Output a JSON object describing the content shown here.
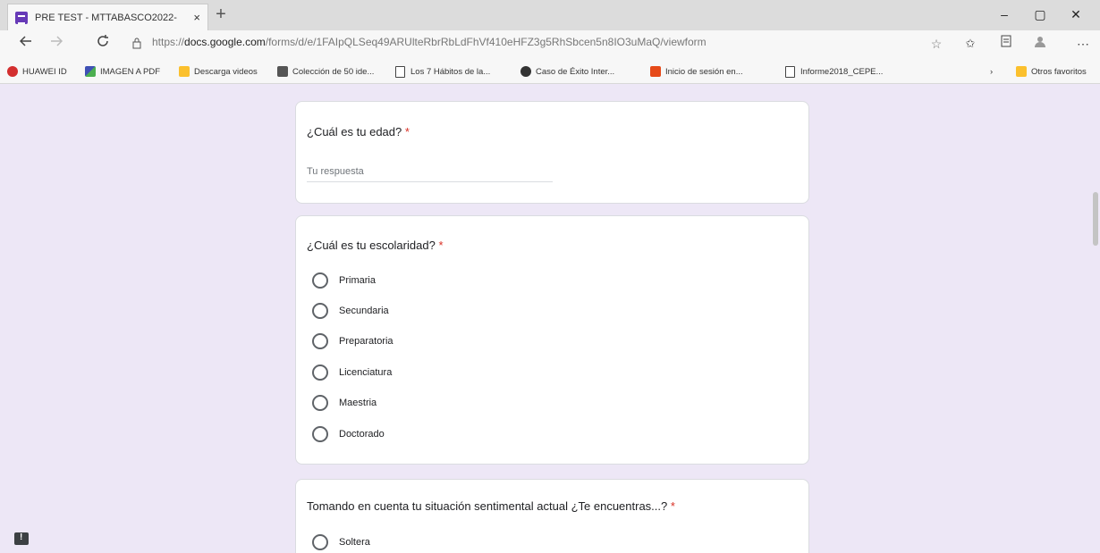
{
  "browser": {
    "tab_title": "PRE TEST - MTTABASCO2022-",
    "tab_close": "×",
    "new_tab": "+",
    "url_prefix": "https://",
    "url_domain": "docs.google.com",
    "url_path": "/forms/d/e/1FAIpQLSeq49ARUlteRbrRbLdFhVf410eHFZ3g5RhSbcen5n8IO3uMaQ/viewform",
    "minimize": "–",
    "restore": "▢",
    "close": "✕"
  },
  "bookmarks": [
    {
      "label": "HUAWEI ID",
      "color": "#d32f2f"
    },
    {
      "label": "IMAGEN A PDF",
      "color": "#3f51b5"
    },
    {
      "label": "Descarga videos",
      "color": "#fbc02d"
    },
    {
      "label": "Colección de 50 ide...",
      "color": "#555555"
    },
    {
      "label": "Los 7 Hábitos de la...",
      "color": "page"
    },
    {
      "label": "Caso de Éxito Inter...",
      "color": "#333333"
    },
    {
      "label": "Inicio de sesión en...",
      "color": "#e64a19"
    },
    {
      "label": "Informe2018_CEPE...",
      "color": "page"
    },
    {
      "label": "Otros favoritos",
      "color": "#fbc02d"
    }
  ],
  "form": {
    "q_age": {
      "title": "¿Cuál es tu edad?",
      "required": "*",
      "placeholder": "Tu respuesta"
    },
    "q_school": {
      "title": "¿Cuál es tu escolaridad?",
      "required": "*",
      "options": [
        "Primaria",
        "Secundaria",
        "Preparatoria",
        "Licenciatura",
        "Maestria",
        "Doctorado"
      ]
    },
    "q_status": {
      "title": "Tomando en cuenta tu situación sentimental actual ¿Te encuentras...?",
      "required": "*",
      "options": [
        "Soltera"
      ]
    }
  },
  "colors": {
    "page_bg": "#ede7f6",
    "accent": "#673ab7",
    "required": "#d93025"
  }
}
